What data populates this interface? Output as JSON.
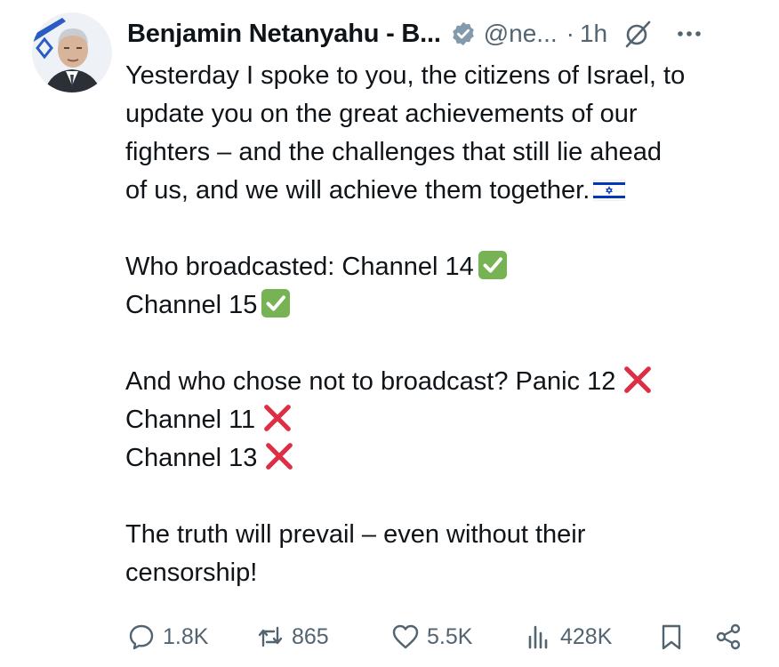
{
  "author": {
    "display_name": "Benjamin Netanyahu - B...",
    "handle": "@ne...",
    "separator": "·",
    "time": "1h"
  },
  "post": {
    "line1": "Yesterday I spoke to you, the citizens of Israel, to",
    "line2": "update you on the great achievements of our",
    "line3": "fighters – and the challenges that still lie ahead",
    "line4": "of us, and we will achieve them together.",
    "line5": "Who broadcasted: Channel 14",
    "line6": "Channel 15",
    "line7": "And who chose not to broadcast? Panic 12",
    "line8": "Channel 11",
    "line9": "Channel 13",
    "line10": "The truth will prevail – even without their",
    "line11": "censorship!"
  },
  "stats": {
    "replies": "1.8K",
    "reposts": "865",
    "likes": "5.5K",
    "views": "428K"
  },
  "icons": {
    "verified": "verified-badge-icon",
    "grok": "grok-icon",
    "more": "more-icon",
    "reply": "reply-icon",
    "repost": "repost-icon",
    "like": "like-icon",
    "views": "views-icon",
    "bookmark": "bookmark-icon",
    "share": "share-icon",
    "flag": "israel-flag-icon",
    "check": "check-mark-icon",
    "cross": "cross-mark-icon"
  },
  "colors": {
    "text": "#0f1419",
    "secondary": "#536471",
    "check_green": "#77b255",
    "cross_red": "#dd2e44",
    "flag_blue": "#0038b8"
  }
}
